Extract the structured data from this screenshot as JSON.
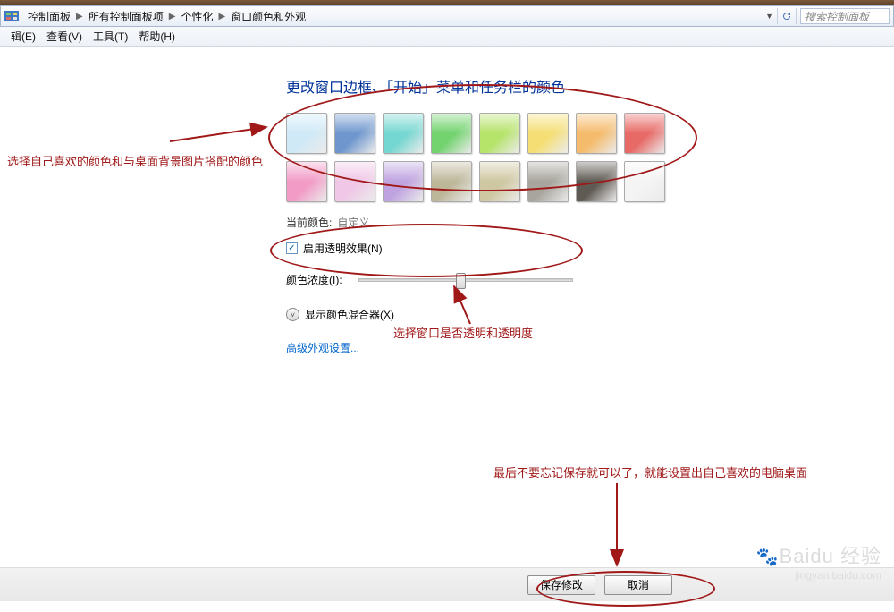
{
  "breadcrumb": {
    "items": [
      "控制面板",
      "所有控制面板项",
      "个性化",
      "窗口颜色和外观"
    ],
    "search_placeholder": "搜索控制面板"
  },
  "menu": {
    "items": [
      "辑(E)",
      "查看(V)",
      "工具(T)",
      "帮助(H)"
    ]
  },
  "main": {
    "title": "更改窗口边框、「开始」菜单和任务栏的颜色",
    "current_color_label": "当前颜色:",
    "current_color_value": "自定义",
    "enable_transparency": "启用透明效果(N)",
    "intensity_label": "颜色浓度(I):",
    "mixer_label": "显示颜色混合器(X)",
    "advanced_link": "高级外观设置...",
    "swatches": [
      [
        "#cfe9f7",
        "#6f97cd",
        "#75d7d1",
        "#73d36f",
        "#b6e36a",
        "#f5df75",
        "#f5bb6c",
        "#e76a66"
      ],
      [
        "#f29bc6",
        "#f0c7e6",
        "#bfa3e0",
        "#bdb79a",
        "#cfc7a1",
        "#a7a59d",
        "#5f5a53",
        "#f4f4f4"
      ]
    ]
  },
  "buttons": {
    "save": "保存修改",
    "cancel": "取消"
  },
  "anno": {
    "pick_color": "选择自己喜欢的颜色和与桌面背景图片搭配的颜色",
    "transparency": "选择窗口是否透明和透明度",
    "save_hint": "最后不要忘记保存就可以了，就能设置出自己喜欢的电脑桌面"
  },
  "watermark": {
    "brand": "Baidu 经验",
    "url": "jingyan.baidu.com"
  }
}
